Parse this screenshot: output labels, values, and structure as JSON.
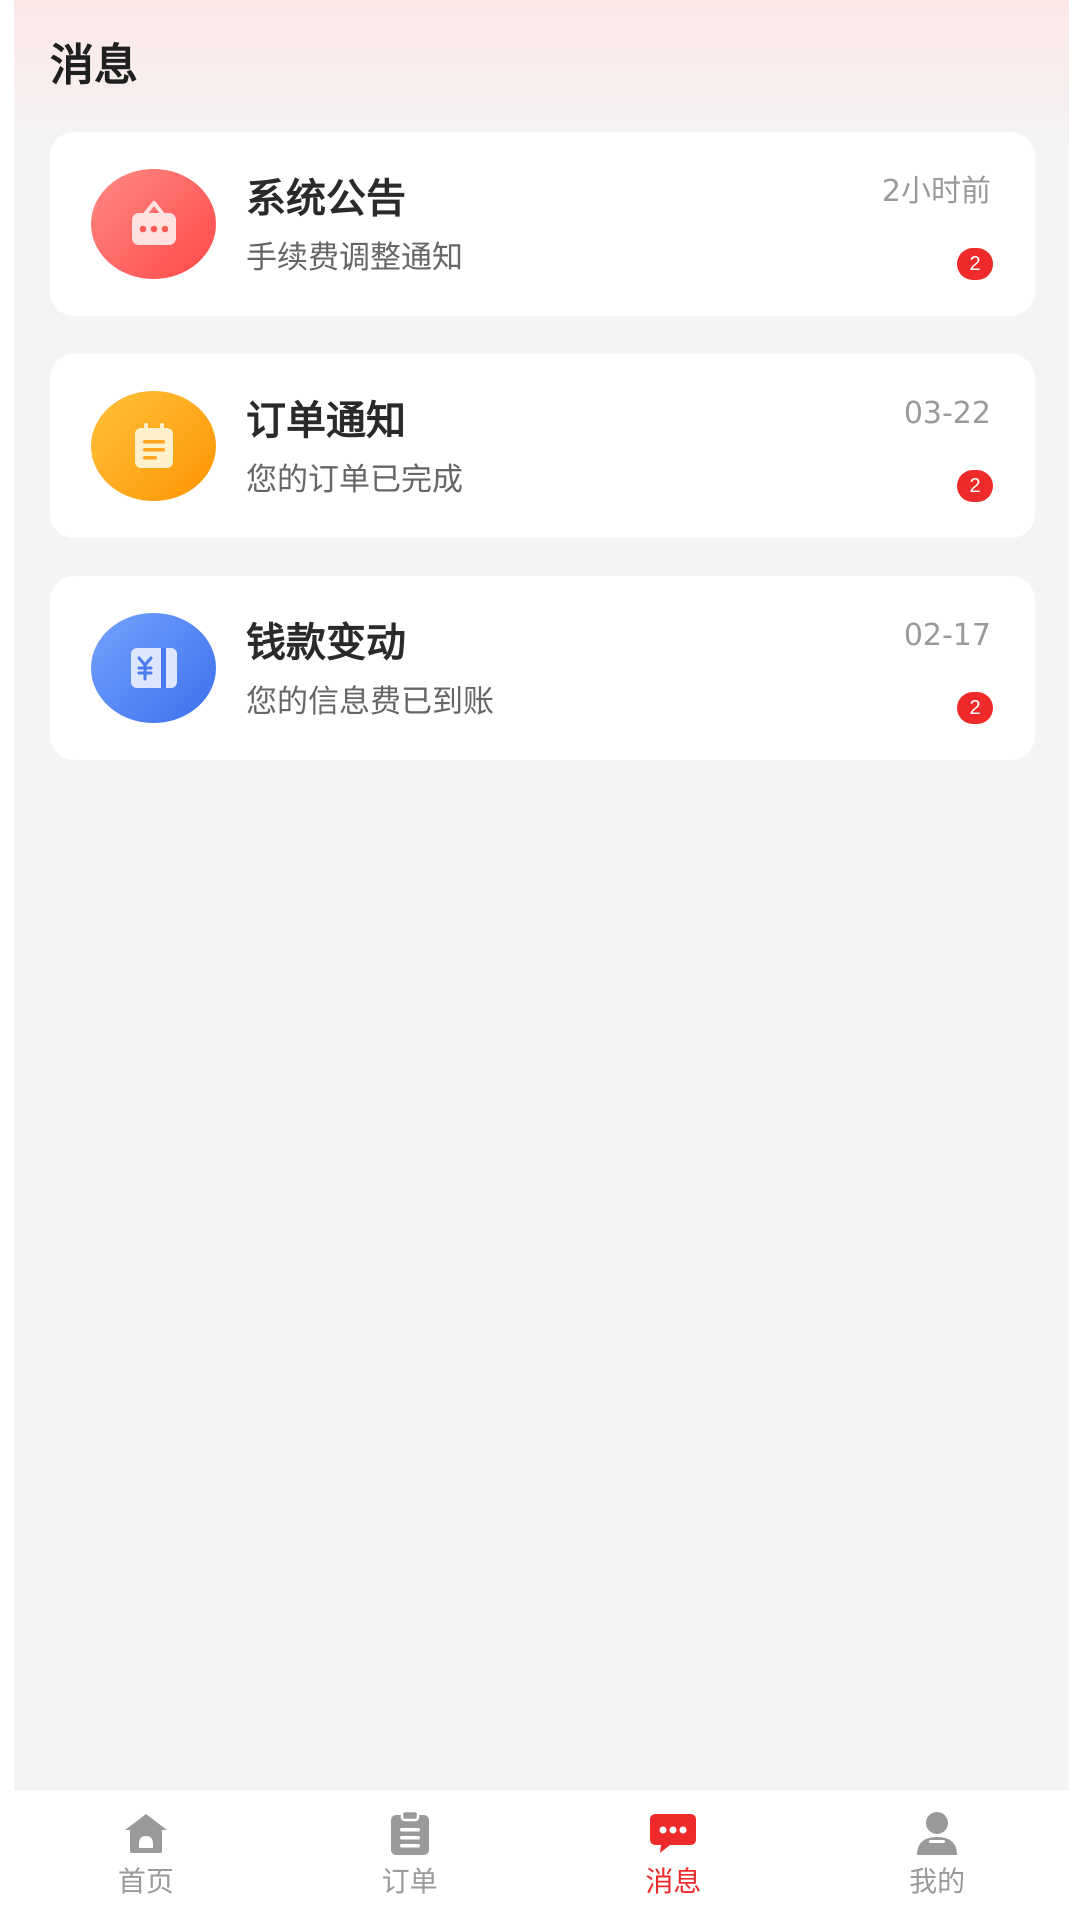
{
  "page": {
    "title": "消息"
  },
  "messages": [
    {
      "icon": "shop-bag-icon",
      "color_start": "#ff7a74",
      "color_end": "#ff4444",
      "title": "系统公告",
      "subtitle": "手续费调整通知",
      "time": "2小时前",
      "badge": "2"
    },
    {
      "icon": "clipboard-icon",
      "color_start": "#ffbb33",
      "color_end": "#ff9500",
      "title": "订单通知",
      "subtitle": "您的订单已完成",
      "time": "03-22",
      "badge": "2"
    },
    {
      "icon": "yuan-card-icon",
      "color_start": "#6b9cff",
      "color_end": "#3f72ee",
      "title": "钱款变动",
      "subtitle": "您的信息费已到账",
      "time": "02-17",
      "badge": "2"
    }
  ],
  "tabbar": {
    "active_color": "#ee2a2a",
    "inactive_color": "#9a9a9a",
    "items": [
      {
        "label": "首页",
        "icon": "home-icon"
      },
      {
        "label": "订单",
        "icon": "clipboard-icon"
      },
      {
        "label": "消息",
        "icon": "chat-bubble-icon",
        "active": true
      },
      {
        "label": "我的",
        "icon": "user-icon"
      }
    ]
  }
}
